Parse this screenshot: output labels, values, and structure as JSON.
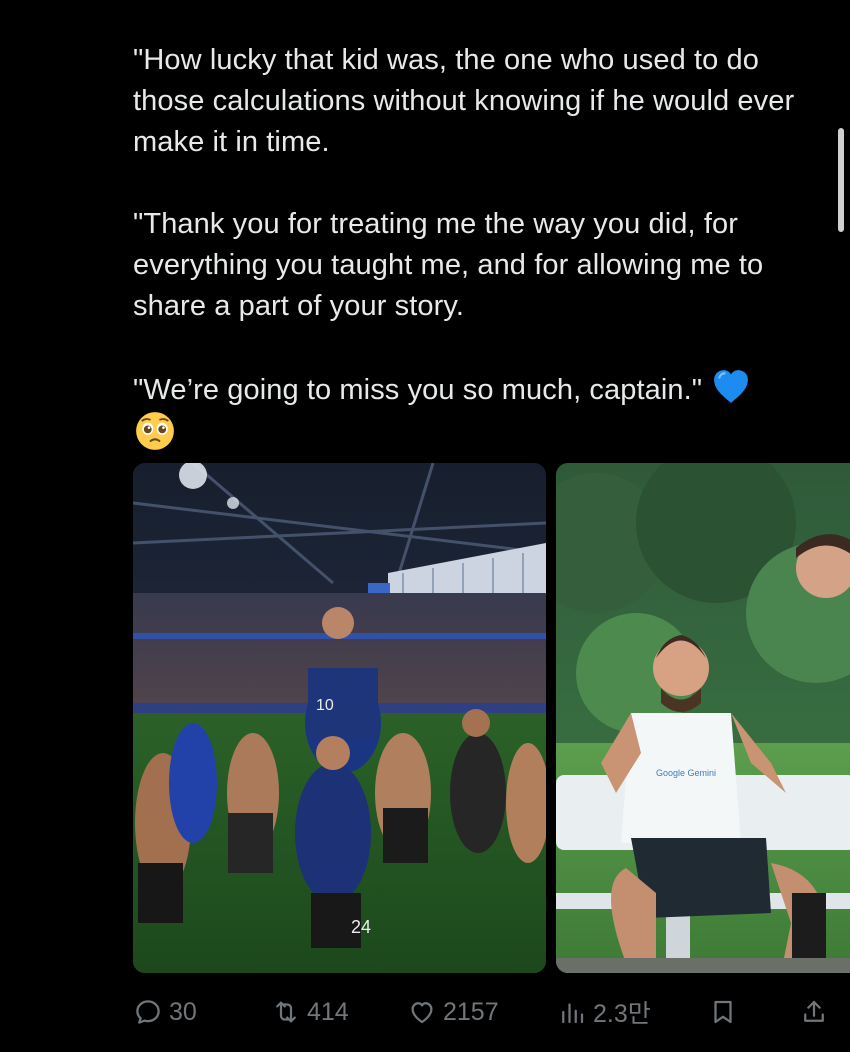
{
  "tweet": {
    "paragraphs": [
      "\"How lucky that kid was, the one who used to do those calculations without knowing if he would ever make it in time.",
      "\"Thank you for treating me the way you did, for everything you taught me, and for allowing me to share a part of your story.",
      "\"We’re going to miss you so much, captain.\""
    ],
    "emojis": [
      "blue-heart",
      "pleading-face"
    ]
  },
  "media": [
    {
      "subject": "stadium-celebration-photo",
      "jersey_numbers": [
        "10",
        "24"
      ]
    },
    {
      "subject": "bench-laughing-photo",
      "shirt_text": "Google Gemini"
    }
  ],
  "actions": {
    "replies": "30",
    "reposts": "414",
    "likes": "2157",
    "views": "2.3만"
  },
  "colors": {
    "background": "#000000",
    "text": "#e7e9ea",
    "muted": "#71767b",
    "heart_emoji": "#1d8cf0"
  }
}
